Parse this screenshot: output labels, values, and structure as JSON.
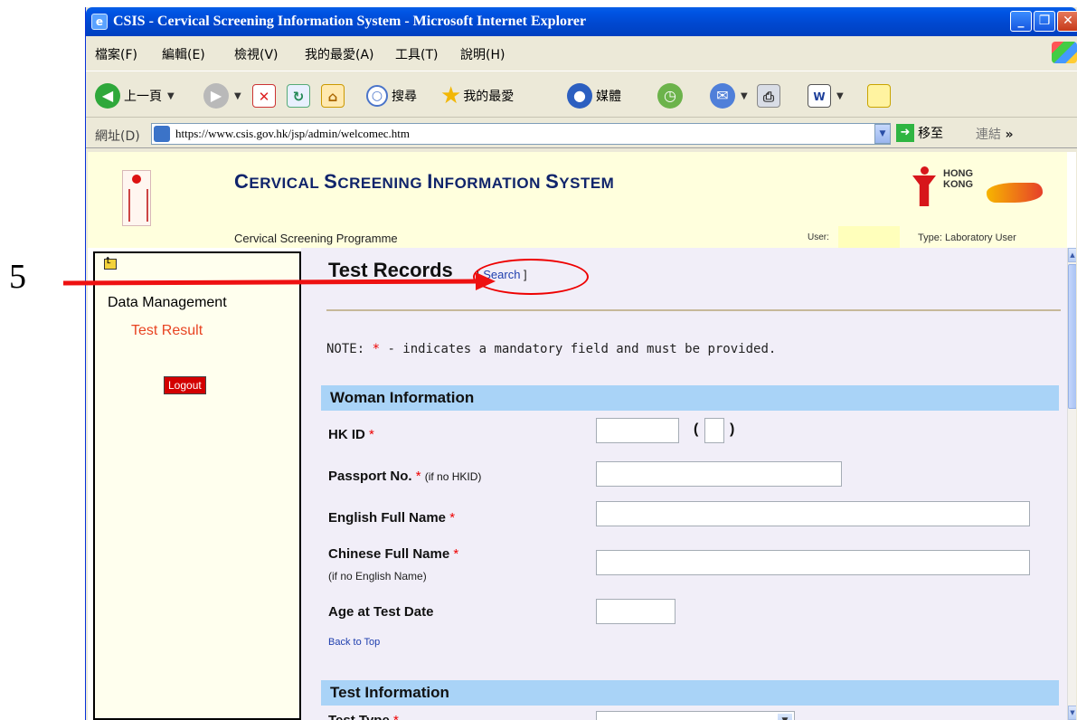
{
  "annotation": {
    "step_number": "5"
  },
  "window": {
    "title": "CSIS - Cervical Screening Information System - Microsoft Internet Explorer",
    "min_glyph": "_",
    "max_glyph": "❐",
    "close_glyph": "✕"
  },
  "menu": {
    "items": [
      "檔案(F)",
      "編輯(E)",
      "檢視(V)",
      "我的最愛(A)",
      "工具(T)",
      "說明(H)"
    ]
  },
  "toolbar": {
    "back_label": "上一頁",
    "search_label": "搜尋",
    "favorites_label": "我的最愛",
    "media_label": "媒體"
  },
  "address": {
    "label": "網址(D)",
    "url": "https://www.csis.gov.hk/jsp/admin/welcomec.htm",
    "go_label": "移至",
    "links_label": "連結"
  },
  "site": {
    "title_parts": [
      {
        "t": "C",
        "big": true
      },
      {
        "t": "ERVICAL ",
        "big": false
      },
      {
        "t": "S",
        "big": true
      },
      {
        "t": "CREENING ",
        "big": false
      },
      {
        "t": "I",
        "big": true
      },
      {
        "t": "NFORMATION ",
        "big": false
      },
      {
        "t": "S",
        "big": true
      },
      {
        "t": "YSTEM",
        "big": false
      }
    ],
    "logo_text_line1": "HONG",
    "logo_text_line2": "KONG",
    "programme": "Cervical Screening Programme",
    "user_label": "User:",
    "user_value": "",
    "type_label": "Type: Laboratory User"
  },
  "sidebar": {
    "heading": "Data Management",
    "link": "Test Result",
    "logout": "Logout"
  },
  "main": {
    "heading": "Test Records",
    "search_open": "[ ",
    "search_link": "Search",
    "search_close": " ]",
    "note_prefix": "NOTE: ",
    "note_star": "*",
    "note_text": " - indicates a mandatory field and must be provided.",
    "woman_section": "Woman Information",
    "hkid_label": "HK ID",
    "passport_label": "Passport No.",
    "passport_hint": "(if no HKID)",
    "english_name_label": "English Full Name",
    "chinese_name_label": "Chinese Full Name",
    "chinese_name_hint": "(if no English Name)",
    "age_label": "Age at Test Date",
    "required_star": "*",
    "back_to_top": "Back to Top",
    "test_section": "Test Information",
    "test_type_label": "Test Type"
  },
  "colors": {
    "titlebar": "#0048d0",
    "section_bar": "#a9d3f7",
    "required": "#e00000",
    "annotation_red": "#ee1111"
  }
}
